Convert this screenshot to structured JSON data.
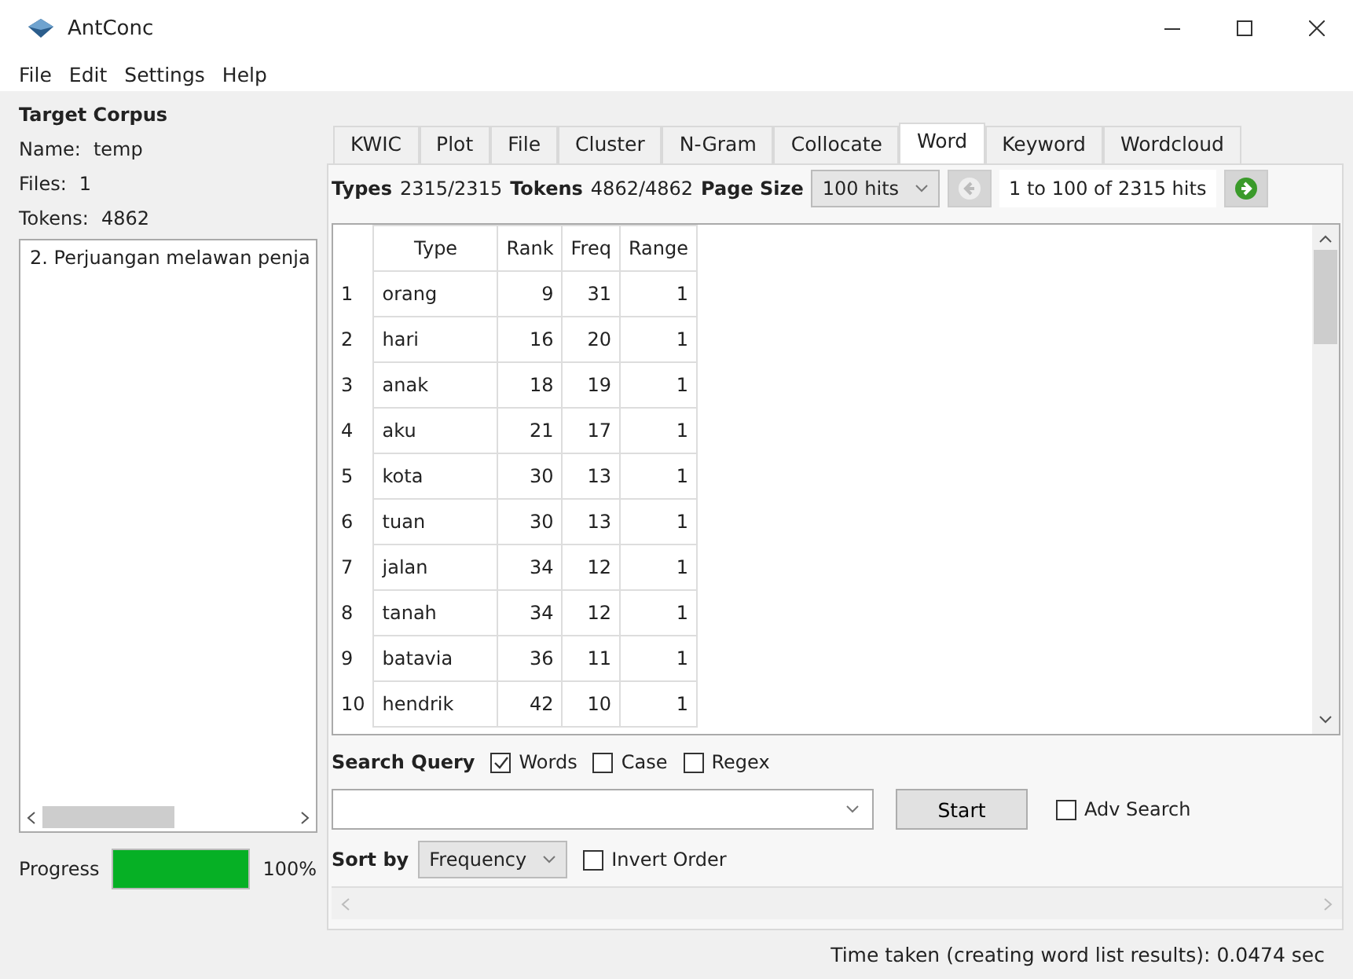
{
  "window": {
    "title": "AntConc"
  },
  "menu": [
    "File",
    "Edit",
    "Settings",
    "Help"
  ],
  "corpus": {
    "heading": "Target Corpus",
    "name_label": "Name:",
    "name": "temp",
    "files_label": "Files:",
    "files": "1",
    "tokens_label": "Tokens:",
    "tokens": "4862",
    "files_list": [
      "2. Perjuangan melawan penja"
    ]
  },
  "progress": {
    "label": "Progress",
    "level": 1,
    "reading": "100%"
  },
  "tabs": [
    {
      "label": "KWIC",
      "selected": false
    },
    {
      "label": "Plot",
      "selected": false
    },
    {
      "label": "File",
      "selected": false
    },
    {
      "label": "Cluster",
      "selected": false
    },
    {
      "label": "N-Gram",
      "selected": false
    },
    {
      "label": "Collocate",
      "selected": false
    },
    {
      "label": "Word",
      "selected": true
    },
    {
      "label": "Keyword",
      "selected": false
    },
    {
      "label": "Wordcloud",
      "selected": false
    }
  ],
  "toolbar": {
    "types_label": "Types",
    "types": "2315/2315",
    "tokens_label": "Tokens",
    "tokens": "4862/4862",
    "page_size_label": "Page Size",
    "page_size": "100 hits",
    "hits": "1 to 100 of 2315 hits"
  },
  "table": {
    "columns": [
      "Type",
      "Rank",
      "Freq",
      "Range"
    ],
    "rows": [
      {
        "index": "1",
        "cells": [
          "orang",
          "9",
          "31",
          "1"
        ]
      },
      {
        "index": "2",
        "cells": [
          "hari",
          "16",
          "20",
          "1"
        ]
      },
      {
        "index": "3",
        "cells": [
          "anak",
          "18",
          "19",
          "1"
        ]
      },
      {
        "index": "4",
        "cells": [
          "aku",
          "21",
          "17",
          "1"
        ]
      },
      {
        "index": "5",
        "cells": [
          "kota",
          "30",
          "13",
          "1"
        ]
      },
      {
        "index": "6",
        "cells": [
          "tuan",
          "30",
          "13",
          "1"
        ]
      },
      {
        "index": "7",
        "cells": [
          "jalan",
          "34",
          "12",
          "1"
        ]
      },
      {
        "index": "8",
        "cells": [
          "tanah",
          "34",
          "12",
          "1"
        ]
      },
      {
        "index": "9",
        "cells": [
          "batavia",
          "36",
          "11",
          "1"
        ]
      },
      {
        "index": "10",
        "cells": [
          "hendrik",
          "42",
          "10",
          "1"
        ]
      }
    ]
  },
  "search": {
    "label": "Search Query",
    "options": [
      {
        "label": "Words",
        "checked": true
      },
      {
        "label": "Case",
        "checked": false
      },
      {
        "label": "Regex",
        "checked": false
      }
    ],
    "start": "Start",
    "adv": {
      "label": "Adv Search",
      "checked": false
    }
  },
  "sort": {
    "label": "Sort by",
    "value": "Frequency",
    "invert": {
      "label": "Invert Order",
      "checked": false
    }
  },
  "status_bar": "Time taken (creating word list results):  0.0474 sec"
}
